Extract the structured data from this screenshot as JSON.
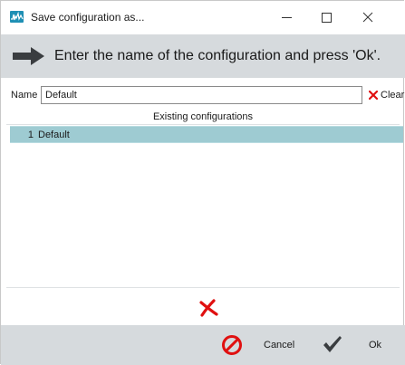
{
  "window": {
    "title": "Save configuration as...",
    "controls": {
      "minimize": "—",
      "maximize": "☐",
      "close": "✕"
    }
  },
  "banner": {
    "icon": "arrow-right-icon",
    "text": "Enter the name of the configuration and press 'Ok'."
  },
  "name_field": {
    "label": "Name",
    "value": "Default"
  },
  "clear_button": {
    "label": "Clear",
    "icon": "x-icon"
  },
  "existing": {
    "header": "Existing configurations",
    "items": [
      {
        "index": "1",
        "name": "Default",
        "selected": true
      }
    ]
  },
  "delete_button": {
    "icon": "delete-x-icon"
  },
  "footer": {
    "cancel_label": "Cancel",
    "ok_label": "Ok"
  },
  "colors": {
    "banner_bg": "#d6dadd",
    "selected_row": "#9ecbd2",
    "accent_red": "#e01010",
    "app_icon": "#1e8fb4"
  }
}
